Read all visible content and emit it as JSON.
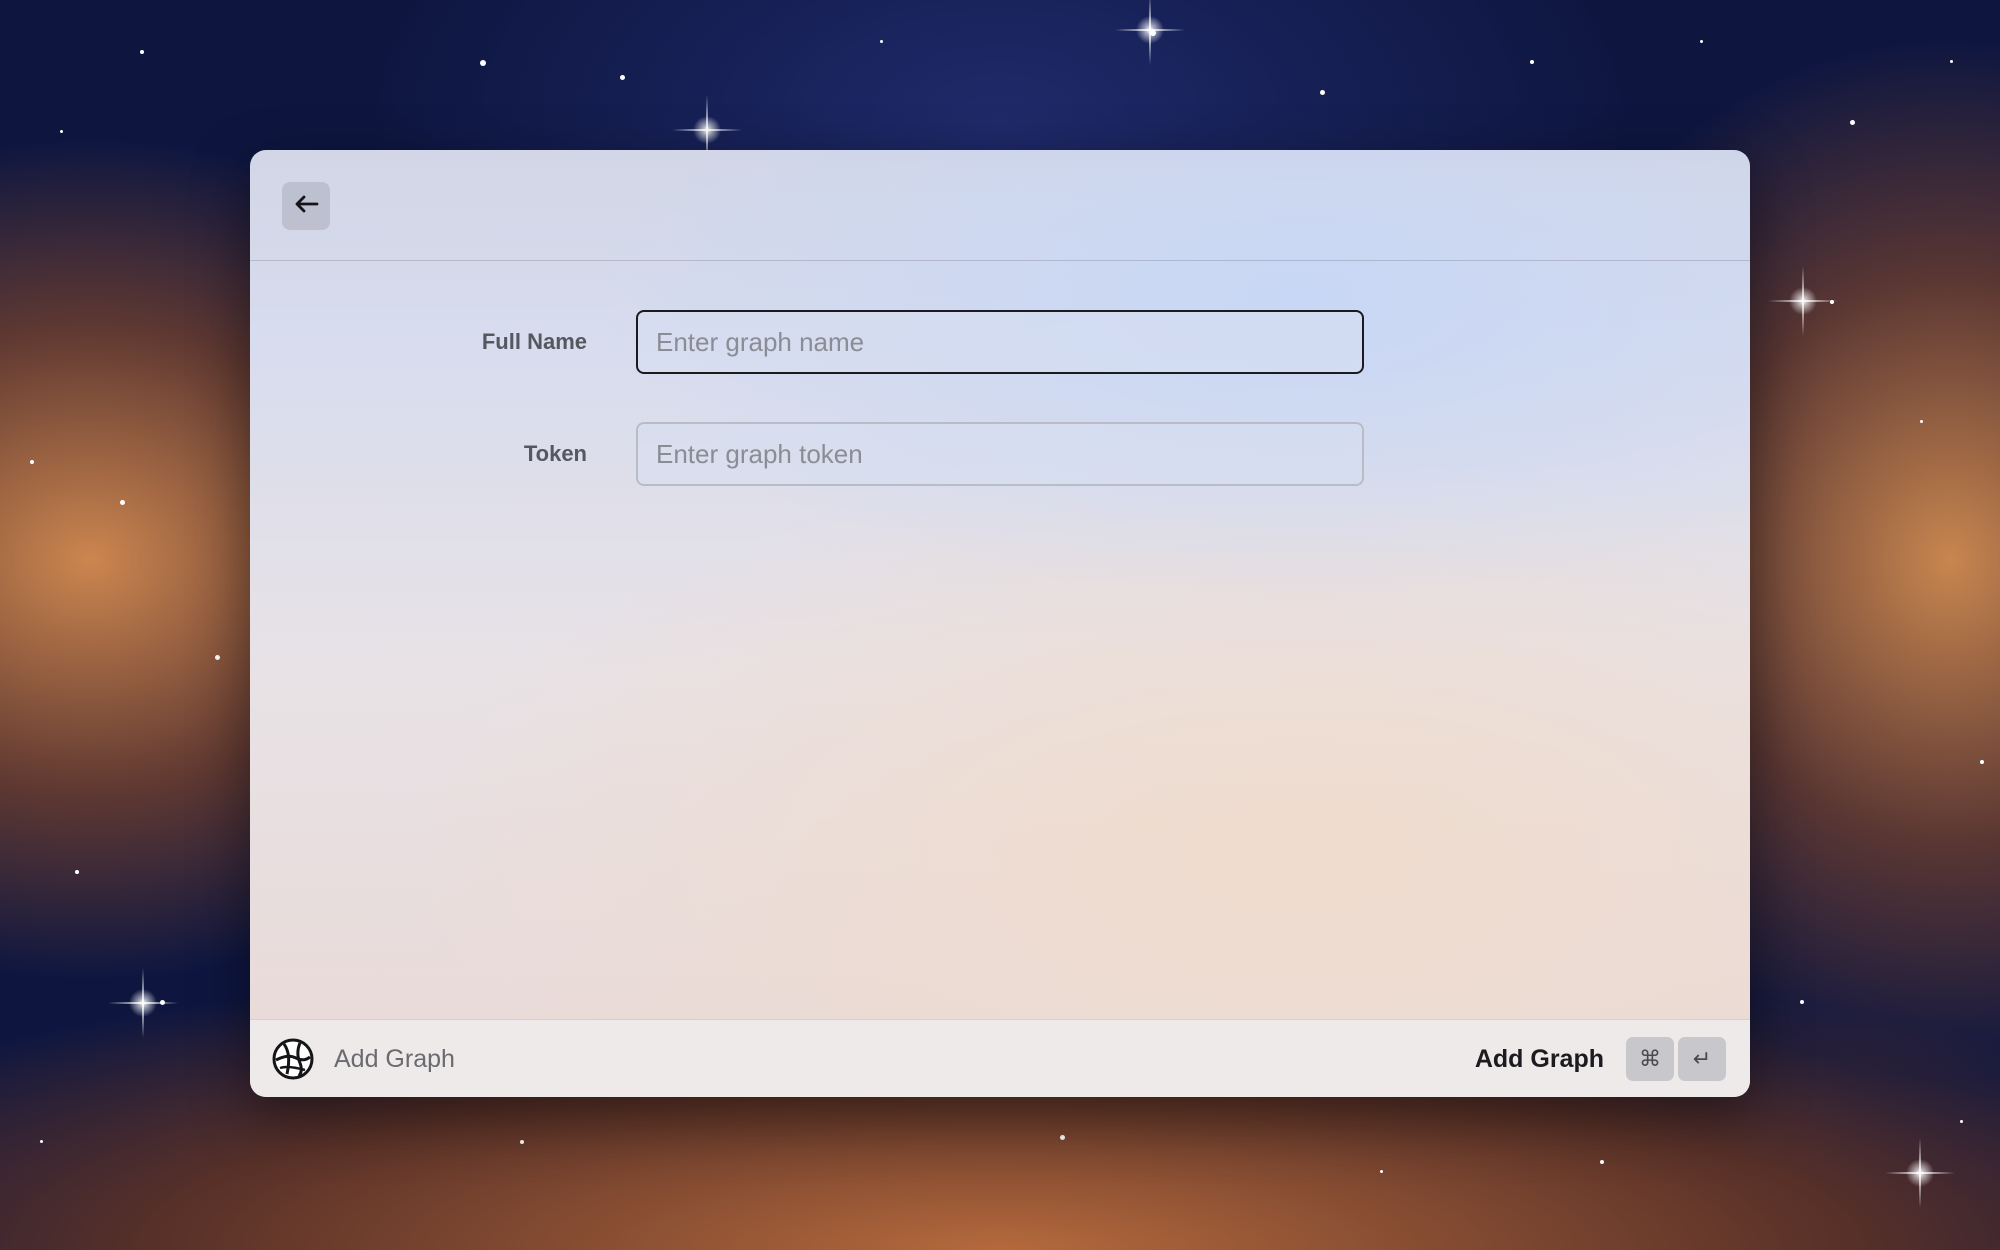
{
  "form": {
    "fields": [
      {
        "label": "Full Name",
        "placeholder": "Enter graph name",
        "value": ""
      },
      {
        "label": "Token",
        "placeholder": "Enter graph token",
        "value": ""
      }
    ]
  },
  "footer": {
    "title": "Add Graph",
    "action_label": "Add Graph",
    "shortcut_keys": [
      "⌘",
      "↵"
    ]
  },
  "icons": {
    "back": "arrow-left-icon",
    "logo": "graph-logo-icon"
  },
  "colors": {
    "focus_border": "#1b1b1f",
    "field_border": "#b9bcc6",
    "label_text": "#55585f",
    "placeholder_text": "#8a8d94"
  }
}
